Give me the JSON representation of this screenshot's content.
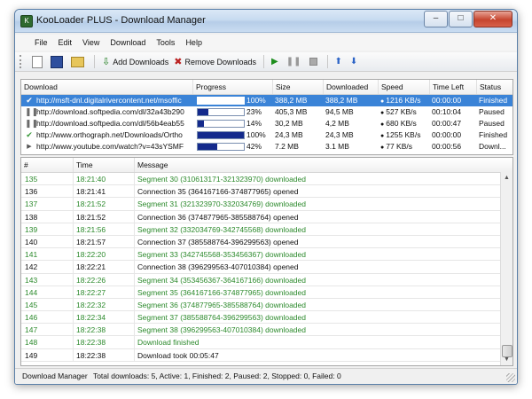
{
  "window": {
    "title": "KooLoader PLUS - Download Manager",
    "controls": {
      "minimize": "–",
      "maximize": "□",
      "close": "✕"
    }
  },
  "menu": [
    "File",
    "Edit",
    "View",
    "Download",
    "Tools",
    "Help"
  ],
  "toolbar": {
    "add_label": "Add Downloads",
    "remove_label": "Remove Downloads"
  },
  "downloads": {
    "columns": [
      "Download",
      "Progress",
      "Size",
      "Downloaded",
      "Speed",
      "Time Left",
      "Status"
    ],
    "rows": [
      {
        "status_icon": "check",
        "url": "http://msft-dnl.digitalrivercontent.net/msoffic",
        "progress": 1.0,
        "percent": "100%",
        "size": "388,2 MB",
        "downloaded": "388,2 MB",
        "speed": "1216 KB/s",
        "time_left": "00:00:00",
        "status": "Finished",
        "selected": true
      },
      {
        "status_icon": "pause",
        "url": "http://download.softpedia.com/dl/32a43b290",
        "progress": 0.23,
        "percent": "23%",
        "size": "405,3 MB",
        "downloaded": "94,5 MB",
        "speed": "527 KB/s",
        "time_left": "00:10:04",
        "status": "Paused",
        "selected": false
      },
      {
        "status_icon": "pause",
        "url": "http://download.softpedia.com/dl/56b4eab55",
        "progress": 0.14,
        "percent": "14%",
        "size": "30,2 MB",
        "downloaded": "4,2 MB",
        "speed": "680 KB/s",
        "time_left": "00:00:47",
        "status": "Paused",
        "selected": false
      },
      {
        "status_icon": "check",
        "url": "http://www.orthograph.net/Downloads/Ortho",
        "progress": 1.0,
        "percent": "100%",
        "size": "24,3 MB",
        "downloaded": "24,3 MB",
        "speed": "1255 KB/s",
        "time_left": "00:00:00",
        "status": "Finished",
        "selected": false
      },
      {
        "status_icon": "arrow",
        "url": "http://www.youtube.com/watch?v=43sYSMF",
        "progress": 0.42,
        "percent": "42%",
        "size": "7.2 MB",
        "downloaded": "3.1 MB",
        "speed": "77 KB/s",
        "time_left": "00:00:56",
        "status": "Downl...",
        "selected": false
      }
    ]
  },
  "log": {
    "columns": [
      "#",
      "Time",
      "Message"
    ],
    "rows": [
      {
        "num": "135",
        "time": "18:21:40",
        "message": "Segment 30 (310613171-321323970) downloaded",
        "green": true
      },
      {
        "num": "136",
        "time": "18:21:41",
        "message": "Connection 35 (364167166-374877965) opened",
        "green": false
      },
      {
        "num": "137",
        "time": "18:21:52",
        "message": "Segment 31 (321323970-332034769) downloaded",
        "green": true
      },
      {
        "num": "138",
        "time": "18:21:52",
        "message": "Connection 36 (374877965-385588764) opened",
        "green": false
      },
      {
        "num": "139",
        "time": "18:21:56",
        "message": "Segment 32 (332034769-342745568) downloaded",
        "green": true
      },
      {
        "num": "140",
        "time": "18:21:57",
        "message": "Connection 37 (385588764-396299563) opened",
        "green": false
      },
      {
        "num": "141",
        "time": "18:22:20",
        "message": "Segment 33 (342745568-353456367) downloaded",
        "green": true
      },
      {
        "num": "142",
        "time": "18:22:21",
        "message": "Connection 38 (396299563-407010384) opened",
        "green": false
      },
      {
        "num": "143",
        "time": "18:22:26",
        "message": "Segment 34 (353456367-364167166) downloaded",
        "green": true
      },
      {
        "num": "144",
        "time": "18:22:27",
        "message": "Segment 35 (364167166-374877965) downloaded",
        "green": true
      },
      {
        "num": "145",
        "time": "18:22:32",
        "message": "Segment 36 (374877965-385588764) downloaded",
        "green": true
      },
      {
        "num": "146",
        "time": "18:22:34",
        "message": "Segment 37 (385588764-396299563) downloaded",
        "green": true
      },
      {
        "num": "147",
        "time": "18:22:38",
        "message": "Segment 38 (396299563-407010384) downloaded",
        "green": true
      },
      {
        "num": "148",
        "time": "18:22:38",
        "message": "Download finished",
        "green": true
      },
      {
        "num": "149",
        "time": "18:22:38",
        "message": "Download took 00:05:47",
        "green": false
      }
    ]
  },
  "statusbar": {
    "app": "Download Manager",
    "summary": "Total downloads: 5, Active: 1, Finished: 2, Paused: 2, Stopped: 0, Failed: 0"
  },
  "colors": {
    "selected_row": "#3a83d7",
    "progress_fill": "#142a8c",
    "log_green": "#2c8a2c"
  }
}
